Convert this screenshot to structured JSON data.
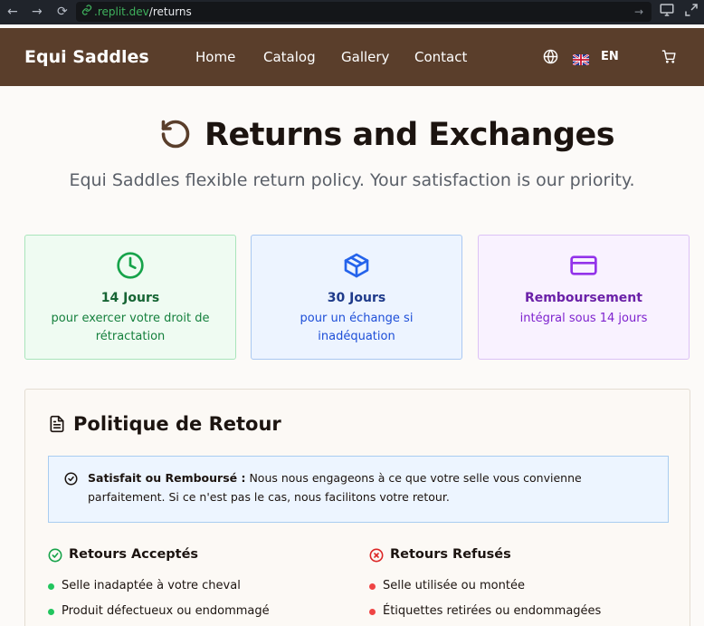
{
  "browser": {
    "url_domain": ".replit.dev",
    "url_path": "/returns",
    "back_glyph": "←",
    "forward_glyph": "→",
    "reload_glyph": "⟳",
    "go_glyph": "→"
  },
  "header": {
    "brand": "Equi Saddles",
    "nav": [
      "Home",
      "Catalog",
      "Gallery",
      "Contact"
    ],
    "language": "EN"
  },
  "hero": {
    "title": "Returns and Exchanges",
    "subtitle": "Equi Saddles flexible return policy. Your satisfaction is our priority."
  },
  "cards": [
    {
      "title": "14 Jours",
      "desc": "pour exercer votre droit de rétractation",
      "icon": "clock-icon",
      "color": "#16a34a"
    },
    {
      "title": "30 Jours",
      "desc": "pour un échange si inadéquation",
      "icon": "package-icon",
      "color": "#2563eb"
    },
    {
      "title": "Remboursement",
      "desc": "intégral sous 14 jours",
      "icon": "credit-card-icon",
      "color": "#9333ea"
    }
  ],
  "policy": {
    "title": "Politique de Retour",
    "notice_bold": "Satisfait ou Remboursé :",
    "notice_text": " Nous nous engageons à ce que votre selle vous convienne parfaitement. Si ce n'est pas le cas, nous facilitons votre retour.",
    "accepted": {
      "heading": "Retours Acceptés",
      "items": [
        "Selle inadaptée à votre cheval",
        "Produit défectueux ou endommagé"
      ]
    },
    "refused": {
      "heading": "Retours Refusés",
      "items": [
        "Selle utilisée ou montée",
        "Étiquettes retirées ou endommagées"
      ]
    }
  }
}
